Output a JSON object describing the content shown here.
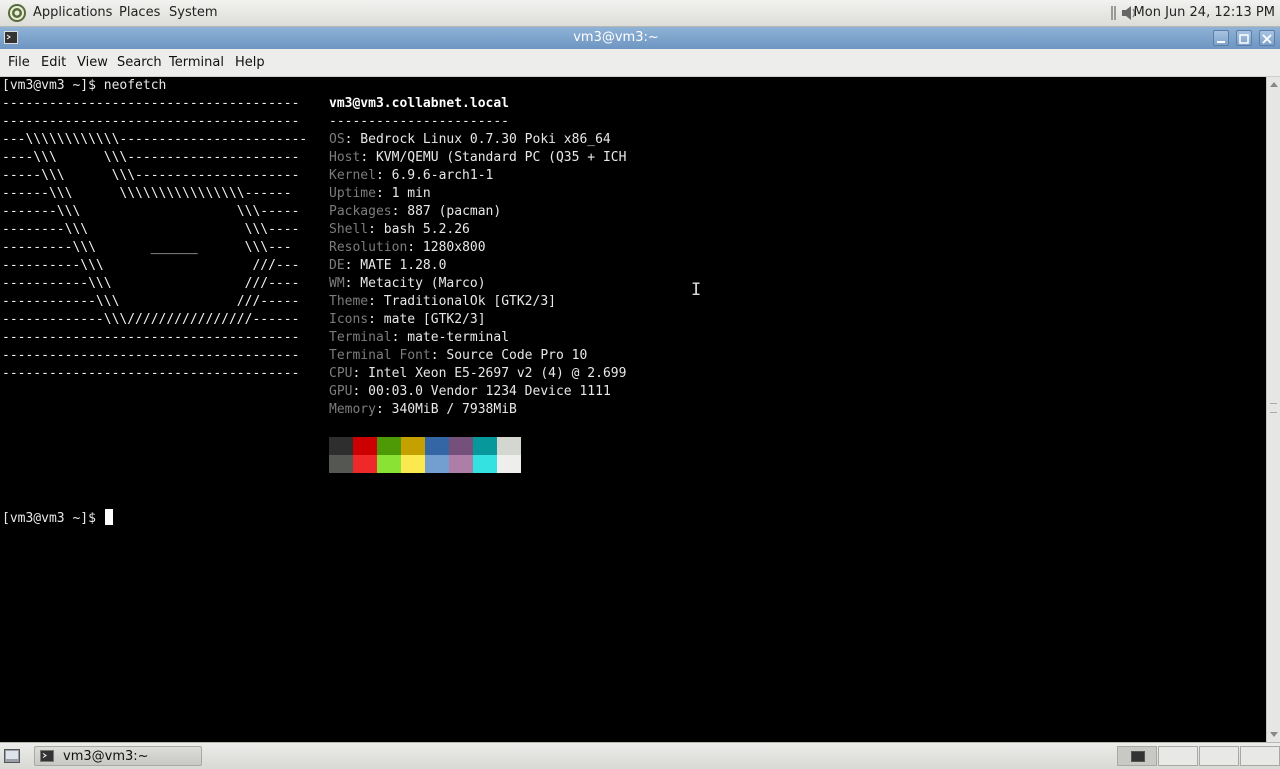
{
  "top_panel": {
    "applications": "Applications",
    "places": "Places",
    "system": "System",
    "clock": "Mon Jun 24, 12:13 PM"
  },
  "window": {
    "title": "vm3@vm3:~"
  },
  "menubar": {
    "file": "File",
    "edit": "Edit",
    "view": "View",
    "search": "Search",
    "terminal": "Terminal",
    "help": "Help"
  },
  "terminal": {
    "command_line": "[vm3@vm3 ~]$ neofetch",
    "prompt": "[vm3@vm3 ~]$ ",
    "ascii_lines": [
      "--------------------------------------",
      "--------------------------------------",
      "---\\\\\\\\\\\\\\\\\\\\\\\\------------------------",
      "----\\\\\\      \\\\\\----------------------",
      "-----\\\\\\      \\\\\\---------------------",
      "------\\\\\\      \\\\\\\\\\\\\\\\\\\\\\\\\\\\\\\\------",
      "-------\\\\\\                    \\\\\\-----",
      "--------\\\\\\                    \\\\\\----",
      "---------\\\\\\       ______      \\\\\\---",
      "----------\\\\\\                   ///---",
      "-----------\\\\\\                 ///----",
      "------------\\\\\\               ///-----",
      "-------------\\\\\\////////////////------",
      "--------------------------------------",
      "--------------------------------------",
      "--------------------------------------"
    ],
    "userhost": "vm3@vm3.collabnet.local",
    "separator": "-----------------------",
    "info": [
      {
        "label": "OS",
        "value": ": Bedrock Linux 0.7.30 Poki x86_64"
      },
      {
        "label": "Host",
        "value": ": KVM/QEMU (Standard PC (Q35 + ICH"
      },
      {
        "label": "Kernel",
        "value": ": 6.9.6-arch1-1"
      },
      {
        "label": "Uptime",
        "value": ": 1 min"
      },
      {
        "label": "Packages",
        "value": ": 887 (pacman)"
      },
      {
        "label": "Shell",
        "value": ": bash 5.2.26"
      },
      {
        "label": "Resolution",
        "value": ": 1280x800"
      },
      {
        "label": "DE",
        "value": ": MATE 1.28.0"
      },
      {
        "label": "WM",
        "value": ": Metacity (Marco)"
      },
      {
        "label": "Theme",
        "value": ": TraditionalOk [GTK2/3]"
      },
      {
        "label": "Icons",
        "value": ": mate [GTK2/3]"
      },
      {
        "label": "Terminal",
        "value": ": mate-terminal"
      },
      {
        "label": "Terminal Font",
        "value": ": Source Code Pro 10"
      },
      {
        "label": "CPU",
        "value": ": Intel Xeon E5-2697 v2 (4) @ 2.699"
      },
      {
        "label": "GPU",
        "value": ": 00:03.0 Vendor 1234 Device 1111"
      },
      {
        "label": "Memory",
        "value": ": 340MiB / 7938MiB"
      }
    ],
    "palette_top": [
      "#2e2e2e",
      "#cc0000",
      "#4e9a06",
      "#c4a000",
      "#3465a4",
      "#75507b",
      "#06989a",
      "#d3d7cf"
    ],
    "palette_bottom": [
      "#555753",
      "#ef2929",
      "#8ae234",
      "#fce94f",
      "#729fcf",
      "#ad7fa8",
      "#34e2e2",
      "#eeeeec"
    ]
  },
  "taskbar": {
    "task_label": "vm3@vm3:~"
  }
}
